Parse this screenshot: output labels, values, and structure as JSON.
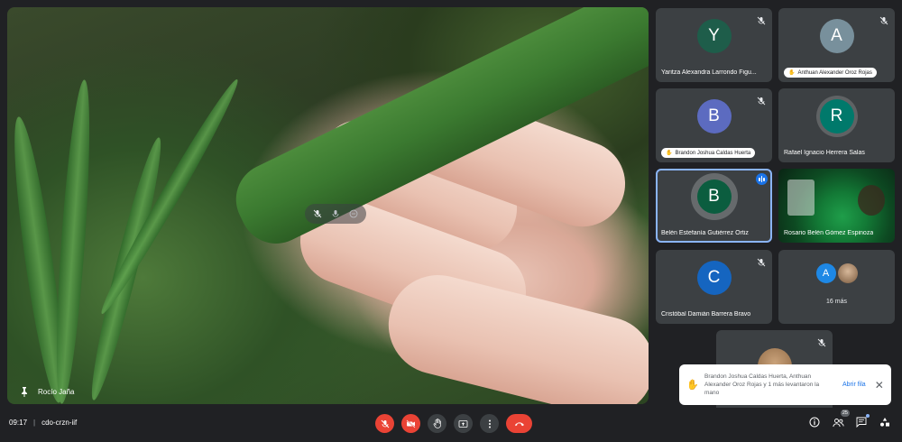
{
  "main": {
    "speaker_name": "Rocío Jaña",
    "icons": [
      "mic-off-icon",
      "mic-icon",
      "more-icon"
    ]
  },
  "participants": [
    {
      "initial": "Y",
      "name": "Yaritza Alexandra Larrondo Figu...",
      "color": "#1e5d4a",
      "muted": true
    },
    {
      "initial": "A",
      "name": "Anthuan Alexander Oroz Rojas",
      "color": "#78909c",
      "muted": true,
      "hand_raised": true
    },
    {
      "initial": "B",
      "name": "Brandon Joshua Caldas Huerta",
      "color": "#5c6bc0",
      "muted": true,
      "hand_raised": true
    },
    {
      "initial": "R",
      "name": "Rafael Ignacio Herrera Salas",
      "color": "#00796b",
      "muted": false
    },
    {
      "initial": "B",
      "name": "Belén Estefanía Gutiérrez Ortiz",
      "color": "#0b5d3f",
      "speaking": true
    },
    {
      "name": "Rosario Belén Gómez Espinoza",
      "video": true
    },
    {
      "initial": "C",
      "name": "Cristóbal Damián Barrera Bravo",
      "color": "#1565c0",
      "muted": true
    }
  ],
  "more": {
    "initial": "A",
    "label": "16 más"
  },
  "toast": {
    "message": "Brandon Joshua Caldas Huerta, Anthuan Alexander Oroz Rojas y 1 más levantaron la mano",
    "action": "Abrir fila"
  },
  "bottom": {
    "time": "09:17",
    "separator": "|",
    "meeting_code": "cdo-crzn-iif",
    "people_count": "25"
  },
  "colors": {
    "accent": "#8ab4f8",
    "danger": "#ea4335",
    "background": "#202124",
    "tile": "#3c4043"
  }
}
